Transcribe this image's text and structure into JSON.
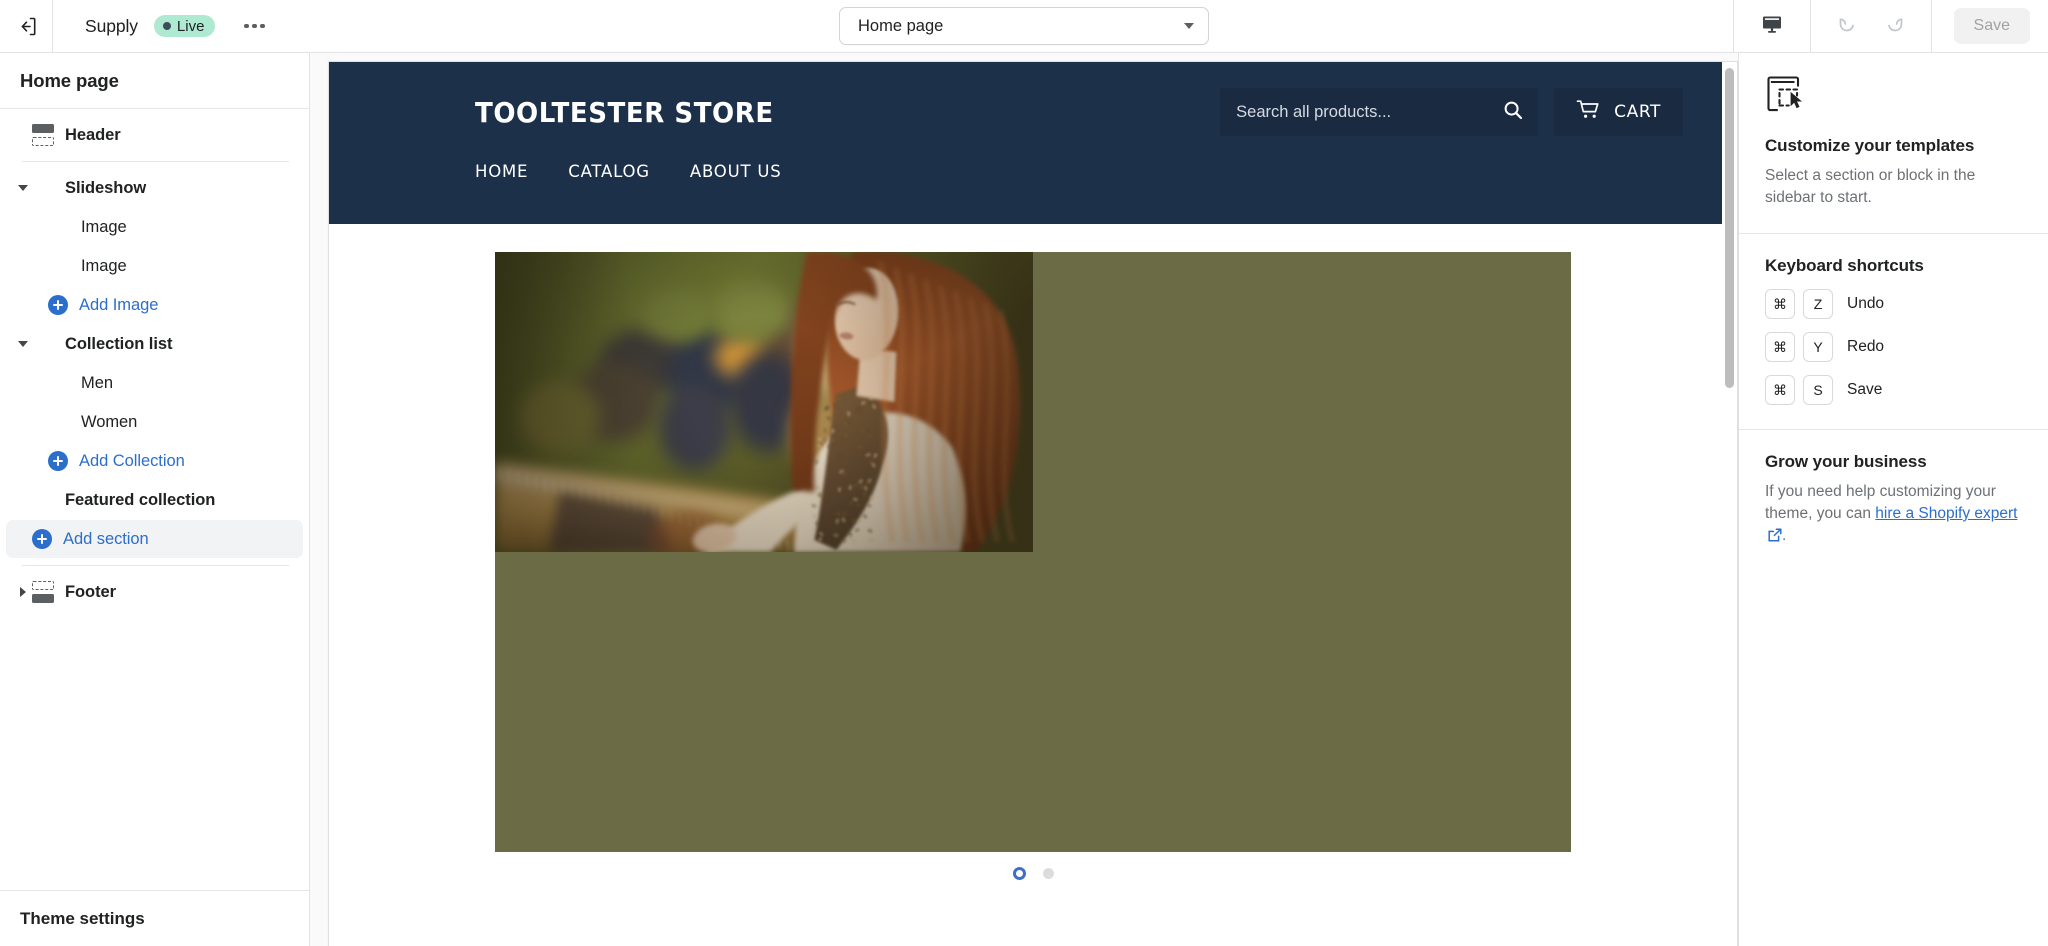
{
  "topbar": {
    "exit_icon": "exit-to-app-icon",
    "shop_name": "Supply",
    "status_badge": "Live",
    "more_icon": "ellipsis-icon",
    "page_selector": {
      "value": "Home page",
      "caret_icon": "chevron-down-icon"
    },
    "device_icon": "desktop-icon",
    "undo_icon": "undo-icon",
    "redo_icon": "redo-icon",
    "save_label": "Save",
    "accent_color": "#2c6ecb",
    "badge_color": "#aee9d1"
  },
  "sidebar": {
    "title": "Home page",
    "items": [
      {
        "label": "Header",
        "type": "section",
        "icon": "header-wireframe-icon",
        "indent": 0,
        "bold": true,
        "arrow": "none"
      },
      {
        "label": "Slideshow",
        "type": "section",
        "icon": "slideshow-thumb",
        "indent": 0,
        "bold": true,
        "arrow": "down"
      },
      {
        "label": "Image",
        "type": "block",
        "icon": "image-thumb-1",
        "indent": 1,
        "bold": false,
        "arrow": "none"
      },
      {
        "label": "Image",
        "type": "block",
        "icon": "image-thumb-2",
        "indent": 1,
        "bold": false,
        "arrow": "none"
      },
      {
        "label": "Add Image",
        "type": "action",
        "icon": "plus-circle-icon",
        "indent": 1,
        "bold": false,
        "arrow": "none"
      },
      {
        "label": "Collection list",
        "type": "section",
        "icon": "collection-thumb",
        "indent": 0,
        "bold": true,
        "arrow": "down"
      },
      {
        "label": "Men",
        "type": "block",
        "icon": "men-thumb",
        "indent": 1,
        "bold": false,
        "arrow": "none"
      },
      {
        "label": "Women",
        "type": "block",
        "icon": "women-thumb",
        "indent": 1,
        "bold": false,
        "arrow": "none"
      },
      {
        "label": "Add Collection",
        "type": "action",
        "icon": "plus-circle-icon",
        "indent": 1,
        "bold": false,
        "arrow": "none"
      },
      {
        "label": "Featured collection",
        "type": "section",
        "icon": "featured-thumb",
        "indent": 0,
        "bold": true,
        "arrow": "none"
      },
      {
        "label": "Add section",
        "type": "action",
        "icon": "plus-circle-icon",
        "indent": 0,
        "bold": false,
        "arrow": "none",
        "selected": true
      },
      {
        "label": "Footer",
        "type": "section",
        "icon": "footer-wireframe-icon",
        "indent": 0,
        "bold": true,
        "arrow": "right"
      }
    ],
    "footer_label": "Theme settings"
  },
  "preview": {
    "store": {
      "logo": "TOOLTESTER STORE",
      "search_placeholder": "Search all products...",
      "search_value": "",
      "search_icon": "search-icon",
      "cart_label": "CART",
      "cart_icon": "shopping-cart-icon",
      "nav": [
        "HOME",
        "CATALOG",
        "ABOUT US"
      ],
      "header_bg": "#1d3049",
      "field_bg": "#1a2a40"
    },
    "slideshow": {
      "slide_count": 2,
      "active_slide": 1,
      "active_dot_color": "#3f6fc4",
      "inactive_dot_color": "#dcdcdc",
      "alt": "Woman with long red hair browsing clothing racks in a boutique"
    }
  },
  "right_panel": {
    "customize": {
      "icon": "template-cursor-icon",
      "title": "Customize your templates",
      "body": "Select a section or block in the sidebar to start."
    },
    "shortcuts": {
      "title": "Keyboard shortcuts",
      "items": [
        {
          "keys": [
            "⌘",
            "Z"
          ],
          "label": "Undo"
        },
        {
          "keys": [
            "⌘",
            "Y"
          ],
          "label": "Redo"
        },
        {
          "keys": [
            "⌘",
            "S"
          ],
          "label": "Save"
        }
      ]
    },
    "grow": {
      "title": "Grow your business",
      "body_before": "If you need help customizing your theme, you can ",
      "link_text": "hire a Shopify expert",
      "link_icon": "external-link-icon",
      "body_after": "."
    }
  }
}
